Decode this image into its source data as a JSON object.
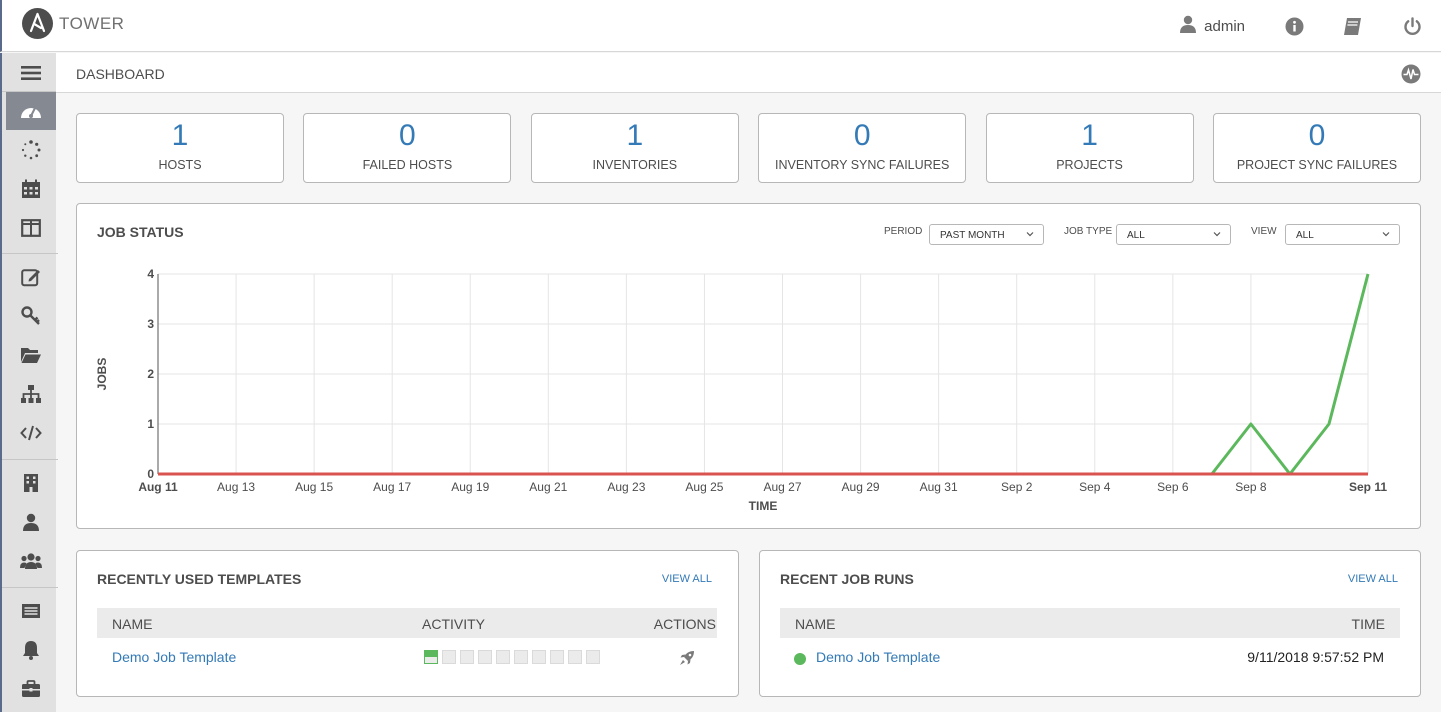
{
  "app": {
    "title": "TOWER"
  },
  "header": {
    "username": "admin"
  },
  "breadcrumb": {
    "label": "DASHBOARD"
  },
  "counts": [
    {
      "value": "1",
      "label": "HOSTS"
    },
    {
      "value": "0",
      "label": "FAILED HOSTS"
    },
    {
      "value": "1",
      "label": "INVENTORIES"
    },
    {
      "value": "0",
      "label": "INVENTORY SYNC FAILURES"
    },
    {
      "value": "1",
      "label": "PROJECTS"
    },
    {
      "value": "0",
      "label": "PROJECT SYNC FAILURES"
    }
  ],
  "job_status": {
    "title": "JOB STATUS",
    "period_label": "PERIOD",
    "period_value": "PAST MONTH",
    "job_type_label": "JOB TYPE",
    "job_type_value": "ALL",
    "view_label": "VIEW",
    "view_value": "ALL"
  },
  "chart_data": {
    "type": "line",
    "xlabel": "TIME",
    "ylabel": "JOBS",
    "ylim": [
      0,
      4
    ],
    "yticks": [
      "0",
      "1",
      "2",
      "3",
      "4"
    ],
    "x_ticks": [
      "Aug 11",
      "Aug 13",
      "Aug 15",
      "Aug 17",
      "Aug 19",
      "Aug 21",
      "Aug 23",
      "Aug 25",
      "Aug 27",
      "Aug 29",
      "Aug 31",
      "Sep 2",
      "Sep 4",
      "Sep 6",
      "Sep 8",
      "Sep 11"
    ],
    "grid": true,
    "x": [
      "Aug 11",
      "Aug 12",
      "Aug 13",
      "Aug 14",
      "Aug 15",
      "Aug 16",
      "Aug 17",
      "Aug 18",
      "Aug 19",
      "Aug 20",
      "Aug 21",
      "Aug 22",
      "Aug 23",
      "Aug 24",
      "Aug 25",
      "Aug 26",
      "Aug 27",
      "Aug 28",
      "Aug 29",
      "Aug 30",
      "Aug 31",
      "Sep 1",
      "Sep 2",
      "Sep 3",
      "Sep 4",
      "Sep 5",
      "Sep 6",
      "Sep 7",
      "Sep 8",
      "Sep 9",
      "Sep 10",
      "Sep 11"
    ],
    "series": [
      {
        "color": "#5cb85c",
        "values": [
          0,
          0,
          0,
          0,
          0,
          0,
          0,
          0,
          0,
          0,
          0,
          0,
          0,
          0,
          0,
          0,
          0,
          0,
          0,
          0,
          0,
          0,
          0,
          0,
          0,
          0,
          0,
          0,
          1,
          0,
          1,
          4
        ]
      },
      {
        "color": "#d9534f",
        "values": [
          0,
          0,
          0,
          0,
          0,
          0,
          0,
          0,
          0,
          0,
          0,
          0,
          0,
          0,
          0,
          0,
          0,
          0,
          0,
          0,
          0,
          0,
          0,
          0,
          0,
          0,
          0,
          0,
          0,
          0,
          0,
          0
        ]
      }
    ]
  },
  "templates": {
    "title": "RECENTLY USED TEMPLATES",
    "view_all": "VIEW ALL",
    "col_name": "NAME",
    "col_activity": "ACTIVITY",
    "col_actions": "ACTIONS",
    "row_name": "Demo Job Template",
    "activity": [
      "success",
      "none",
      "none",
      "none",
      "none",
      "none",
      "none",
      "none",
      "none",
      "none"
    ]
  },
  "runs": {
    "title": "RECENT JOB RUNS",
    "view_all": "VIEW ALL",
    "col_name": "NAME",
    "col_time": "TIME",
    "row_name": "Demo Job Template",
    "row_time": "9/11/2018 9:57:52 PM",
    "row_status": "success"
  },
  "icons": {
    "sidebar": [
      "menu-icon",
      "dashboard-icon",
      "jobs-icon",
      "schedules-icon",
      "portal-mode-icon",
      "templates-icon",
      "credentials-icon",
      "projects-icon",
      "inventories-icon",
      "inventory-scripts-icon",
      "organizations-icon",
      "users-icon",
      "teams-icon",
      "credential-types-icon",
      "notifications-icon",
      "management-jobs-icon"
    ]
  }
}
